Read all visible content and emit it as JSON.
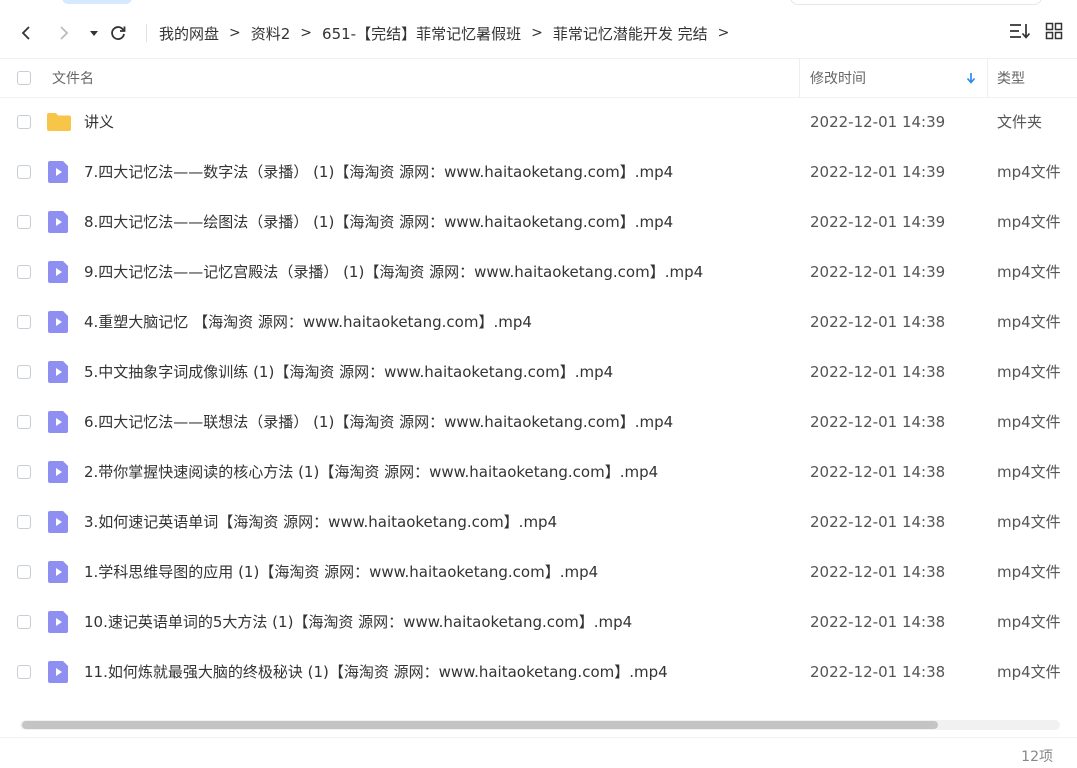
{
  "breadcrumb": {
    "items": [
      "我的网盘",
      "资料2",
      "651-【完结】菲常记忆暑假班",
      "菲常记忆潜能开发 完结"
    ],
    "separator": ">"
  },
  "header": {
    "name_label": "文件名",
    "time_label": "修改时间",
    "type_label": "类型"
  },
  "files": [
    {
      "name": "讲义",
      "time": "2022-12-01 14:39",
      "type": "文件夹",
      "icon": "folder-icon"
    },
    {
      "name": "7.四大记忆法——数字法（录播） (1)【海淘资 源网：www.haitaoketang.com】.mp4",
      "time": "2022-12-01 14:39",
      "type": "mp4文件",
      "icon": "video-file-icon"
    },
    {
      "name": "8.四大记忆法——绘图法（录播） (1)【海淘资 源网：www.haitaoketang.com】.mp4",
      "time": "2022-12-01 14:39",
      "type": "mp4文件",
      "icon": "video-file-icon"
    },
    {
      "name": "9.四大记忆法——记忆宫殿法（录播） (1)【海淘资 源网：www.haitaoketang.com】.mp4",
      "time": "2022-12-01 14:39",
      "type": "mp4文件",
      "icon": "video-file-icon"
    },
    {
      "name": "4.重塑大脑记忆 【海淘资 源网：www.haitaoketang.com】.mp4",
      "time": "2022-12-01 14:38",
      "type": "mp4文件",
      "icon": "video-file-icon"
    },
    {
      "name": "5.中文抽象字词成像训练 (1)【海淘资 源网：www.haitaoketang.com】.mp4",
      "time": "2022-12-01 14:38",
      "type": "mp4文件",
      "icon": "video-file-icon"
    },
    {
      "name": "6.四大记忆法——联想法（录播） (1)【海淘资 源网：www.haitaoketang.com】.mp4",
      "time": "2022-12-01 14:38",
      "type": "mp4文件",
      "icon": "video-file-icon"
    },
    {
      "name": "2.带你掌握快速阅读的核心方法 (1)【海淘资 源网：www.haitaoketang.com】.mp4",
      "time": "2022-12-01 14:38",
      "type": "mp4文件",
      "icon": "video-file-icon"
    },
    {
      "name": "3.如何速记英语单词【海淘资 源网：www.haitaoketang.com】.mp4",
      "time": "2022-12-01 14:38",
      "type": "mp4文件",
      "icon": "video-file-icon"
    },
    {
      "name": "1.学科思维导图的应用 (1)【海淘资 源网：www.haitaoketang.com】.mp4",
      "time": "2022-12-01 14:38",
      "type": "mp4文件",
      "icon": "video-file-icon"
    },
    {
      "name": "10.速记英语单词的5大方法 (1)【海淘资 源网：www.haitaoketang.com】.mp4",
      "time": "2022-12-01 14:38",
      "type": "mp4文件",
      "icon": "video-file-icon"
    },
    {
      "name": "11.如何炼就最强大脑的终极秘诀 (1)【海淘资 源网：www.haitaoketang.com】.mp4",
      "time": "2022-12-01 14:38",
      "type": "mp4文件",
      "icon": "video-file-icon"
    }
  ],
  "footer": {
    "count": "12项"
  },
  "colors": {
    "folder": "#f7c548",
    "video": "#8e8ff0",
    "accent": "#2b8cf4"
  }
}
